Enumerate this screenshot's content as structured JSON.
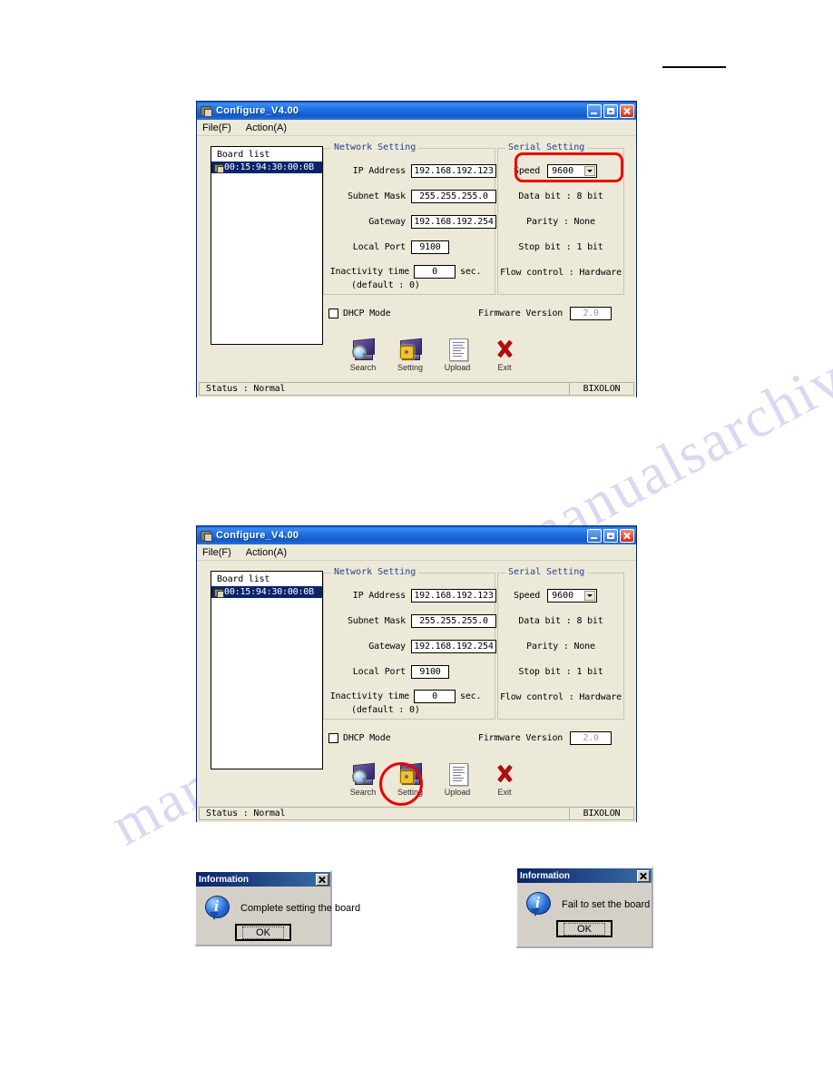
{
  "page": {
    "watermark_text": "manualsarchive.com",
    "top_rule": true
  },
  "window1": {
    "title": "Configure_V4.00",
    "menu": [
      {
        "label": "File(F)",
        "mnemonic": "F"
      },
      {
        "label": "Action(A)",
        "mnemonic": "A"
      }
    ],
    "board_list": {
      "header": "Board list",
      "items": [
        "00:15:94:30:00:0B"
      ]
    },
    "network_setting": {
      "legend": "Network Setting",
      "ip_address_label": "IP Address",
      "ip_address_value": "192.168.192.123",
      "subnet_mask_label": "Subnet Mask",
      "subnet_mask_value": "255.255.255.0",
      "gateway_label": "Gateway",
      "gateway_value": "192.168.192.254",
      "local_port_label": "Local Port",
      "local_port_value": "9100",
      "inactivity_label": "Inactivity time",
      "inactivity_value": "0",
      "inactivity_unit": "sec.",
      "inactivity_default": "(default : 0)"
    },
    "serial_setting": {
      "legend": "Serial Setting",
      "speed_label": "Speed",
      "speed_value": "9600",
      "data_bit": "Data bit : 8 bit",
      "parity": "Parity : None",
      "stop_bit": "Stop bit : 1 bit",
      "flow_control": "Flow control : Hardware"
    },
    "dhcp_label": "DHCP Mode",
    "dhcp_checked": false,
    "firmware_label": "Firmware Version",
    "firmware_value": "2.0",
    "toolbar": [
      {
        "label": "Search",
        "icon": "monitor-magnifier-icon"
      },
      {
        "label": "Setting",
        "icon": "monitor-gear-icon"
      },
      {
        "label": "Upload",
        "icon": "document-icon"
      },
      {
        "label": "Exit",
        "icon": "red-x-icon"
      }
    ],
    "status_left": "Status : Normal",
    "status_right": "BIXOLON",
    "highlight": {
      "target": "speed-combo",
      "color": "#ee0000"
    }
  },
  "window2": {
    "title": "Configure_V4.00",
    "menu": [
      {
        "label": "File(F)",
        "mnemonic": "F"
      },
      {
        "label": "Action(A)",
        "mnemonic": "A"
      }
    ],
    "board_list": {
      "header": "Board list",
      "items": [
        "00:15:94:30:00:0B"
      ]
    },
    "network_setting": {
      "legend": "Network Setting",
      "ip_address_label": "IP Address",
      "ip_address_value": "192.168.192.123",
      "subnet_mask_label": "Subnet Mask",
      "subnet_mask_value": "255.255.255.0",
      "gateway_label": "Gateway",
      "gateway_value": "192.168.192.254",
      "local_port_label": "Local Port",
      "local_port_value": "9100",
      "inactivity_label": "Inactivity time",
      "inactivity_value": "0",
      "inactivity_unit": "sec.",
      "inactivity_default": "(default : 0)"
    },
    "serial_setting": {
      "legend": "Serial Setting",
      "speed_label": "Speed",
      "speed_value": "9600",
      "data_bit": "Data bit : 8 bit",
      "parity": "Parity : None",
      "stop_bit": "Stop bit : 1 bit",
      "flow_control": "Flow control : Hardware"
    },
    "dhcp_label": "DHCP Mode",
    "dhcp_checked": false,
    "firmware_label": "Firmware Version",
    "firmware_value": "2.0",
    "toolbar": [
      {
        "label": "Search",
        "icon": "monitor-magnifier-icon"
      },
      {
        "label": "Setting",
        "icon": "monitor-gear-icon"
      },
      {
        "label": "Upload",
        "icon": "document-icon"
      },
      {
        "label": "Exit",
        "icon": "red-x-icon"
      }
    ],
    "status_left": "Status : Normal",
    "status_right": "BIXOLON",
    "highlight": {
      "target": "setting-toolbar-button",
      "color": "#ee0000"
    }
  },
  "dialog_success": {
    "title": "Information",
    "message": "Complete setting the board",
    "ok_label": "OK",
    "icon": "info-icon"
  },
  "dialog_fail": {
    "title": "Information",
    "message": "Fail to set the board",
    "ok_label": "OK",
    "icon": "info-icon"
  }
}
